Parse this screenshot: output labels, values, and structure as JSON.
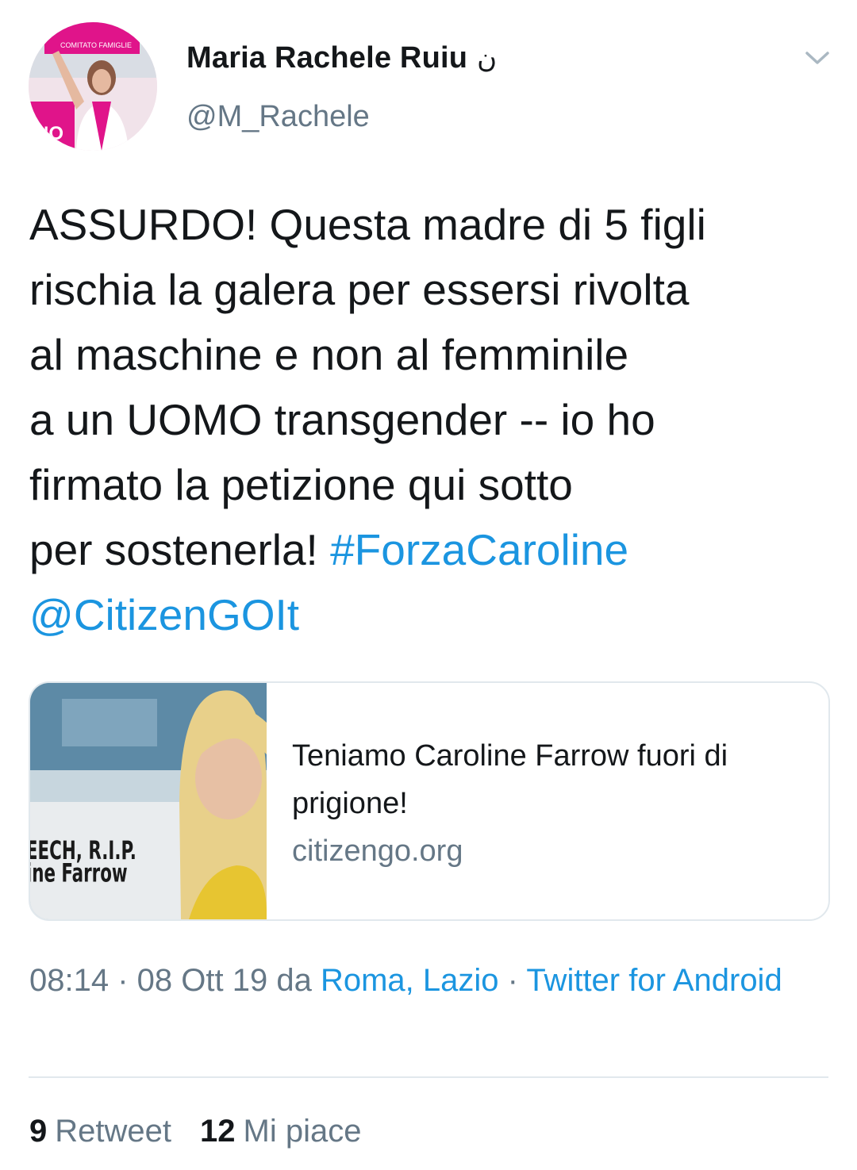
{
  "author": {
    "display_name": "Maria Rachele Ruiu",
    "name_symbol": "ن",
    "handle": "@M_Rachele",
    "avatar_text_top": "COMITATO FAMIGLIE",
    "avatar_text_badge": "NO"
  },
  "tweet": {
    "text_part1": "ASSURDO! Questa madre di 5 figli\nrischia la galera per essersi rivolta\nal maschine e non al femminile\na un UOMO transgender -- io ho\nfirmato la petizione qui sotto\nper sostenerla! ",
    "hashtag": "#ForzaCaroline",
    "mention": "@CitizenGOIt"
  },
  "card": {
    "title": "Teniamo Caroline Farrow fuori di prigione!",
    "domain": "citizengo.org",
    "thumb_caption_line1": "EECH, R.I.P.",
    "thumb_caption_line2": "ine Farrow"
  },
  "meta": {
    "time": "08:14",
    "sep1": " · ",
    "date": "08 Ott 19",
    "from_word": " da ",
    "location": "Roma, Lazio",
    "sep2": " · ",
    "client": "Twitter for Android"
  },
  "stats": {
    "retweets_count": "9",
    "retweets_label": "Retweet",
    "likes_count": "12",
    "likes_label": "Mi piace"
  },
  "colors": {
    "link": "#1b95e0",
    "muted": "#657786",
    "text": "#14171a",
    "border": "#e1e8ed",
    "avatar_accent": "#e0148a"
  },
  "icons": {
    "caret": "chevron-down-icon"
  }
}
